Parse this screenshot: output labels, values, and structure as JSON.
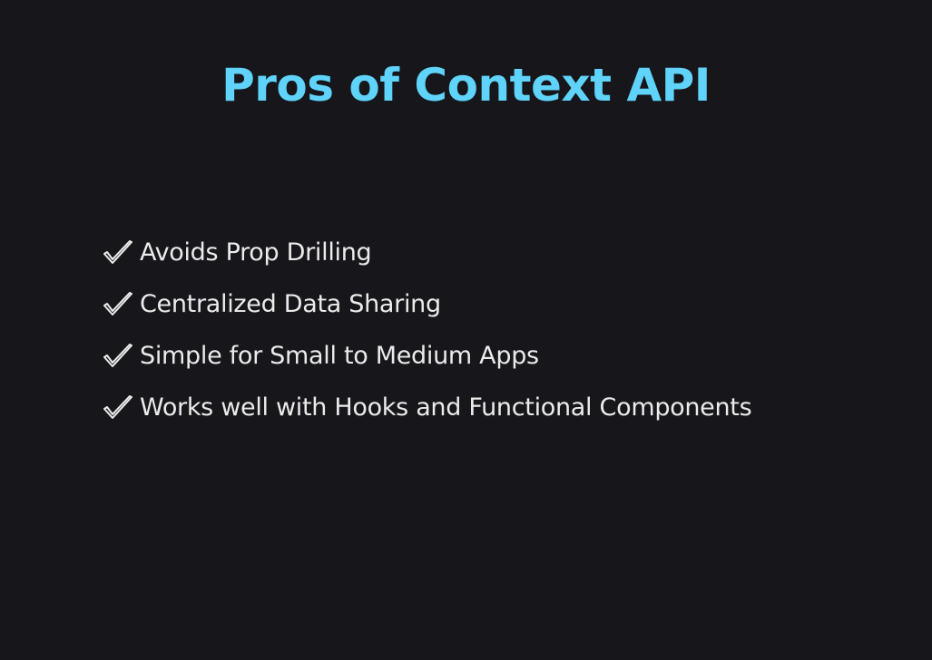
{
  "slide": {
    "title": "Pros of Context API",
    "background_color": "#16161b",
    "title_color": "#5fd3f9",
    "text_color": "#ebebeb",
    "bullet_icon": "check-mark-icon",
    "items": [
      {
        "text": "Avoids Prop Drilling"
      },
      {
        "text": "Centralized Data Sharing"
      },
      {
        "text": "Simple for Small to Medium Apps"
      },
      {
        "text": "Works well with Hooks and Functional Components"
      }
    ]
  }
}
